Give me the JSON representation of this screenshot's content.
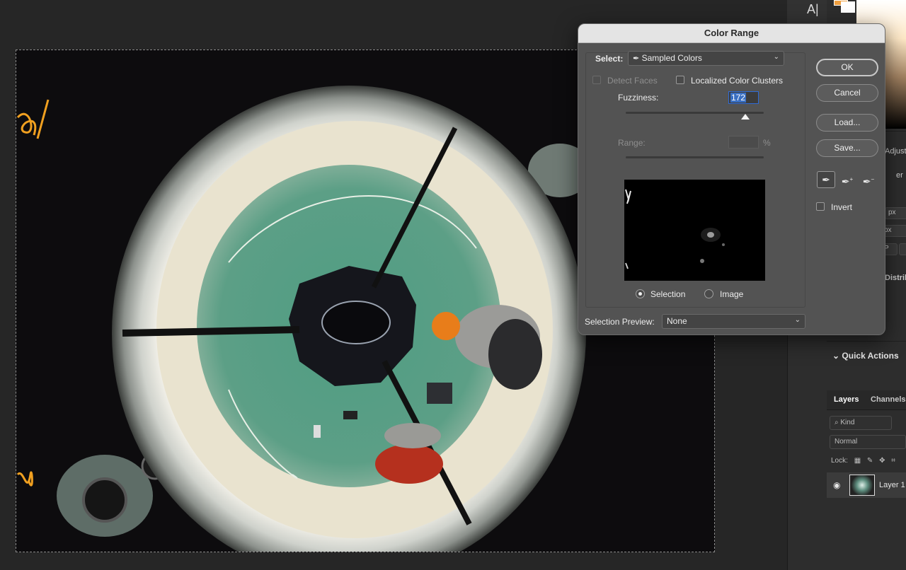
{
  "dialog": {
    "title": "Color Range",
    "select_label": "Select:",
    "select_value": "Sampled Colors",
    "detect_faces_label": "Detect Faces",
    "localized_label": "Localized Color Clusters",
    "fuzziness_label": "Fuzziness:",
    "fuzziness_value": "172",
    "range_label": "Range:",
    "range_unit": "%",
    "selection_label": "Selection",
    "image_label": "Image",
    "selection_preview_label": "Selection Preview:",
    "selection_preview_value": "None",
    "buttons": {
      "ok": "OK",
      "cancel": "Cancel",
      "load": "Load...",
      "save": "Save..."
    },
    "invert_label": "Invert"
  },
  "tools": {
    "type_tool": "A|"
  },
  "right_panel": {
    "adjust_tab_peek": "Adjust",
    "peek_er": "er",
    "px_1": "px",
    "px_2": "px",
    "p_box": "P",
    "distribute_peek": "Distribu",
    "quick_actions": "Quick Actions",
    "layers_tab": "Layers",
    "channels_tab": "Channels",
    "kind_placeholder": "Kind",
    "blend_mode": "Normal",
    "lock_label": "Lock:",
    "layer_name": "Layer 1"
  },
  "colors": {
    "accent_blue": "#2f6bd6",
    "foreground_swatch": "#f0a040",
    "background_swatch": "#ffffff",
    "scribble": "#f0a020"
  }
}
